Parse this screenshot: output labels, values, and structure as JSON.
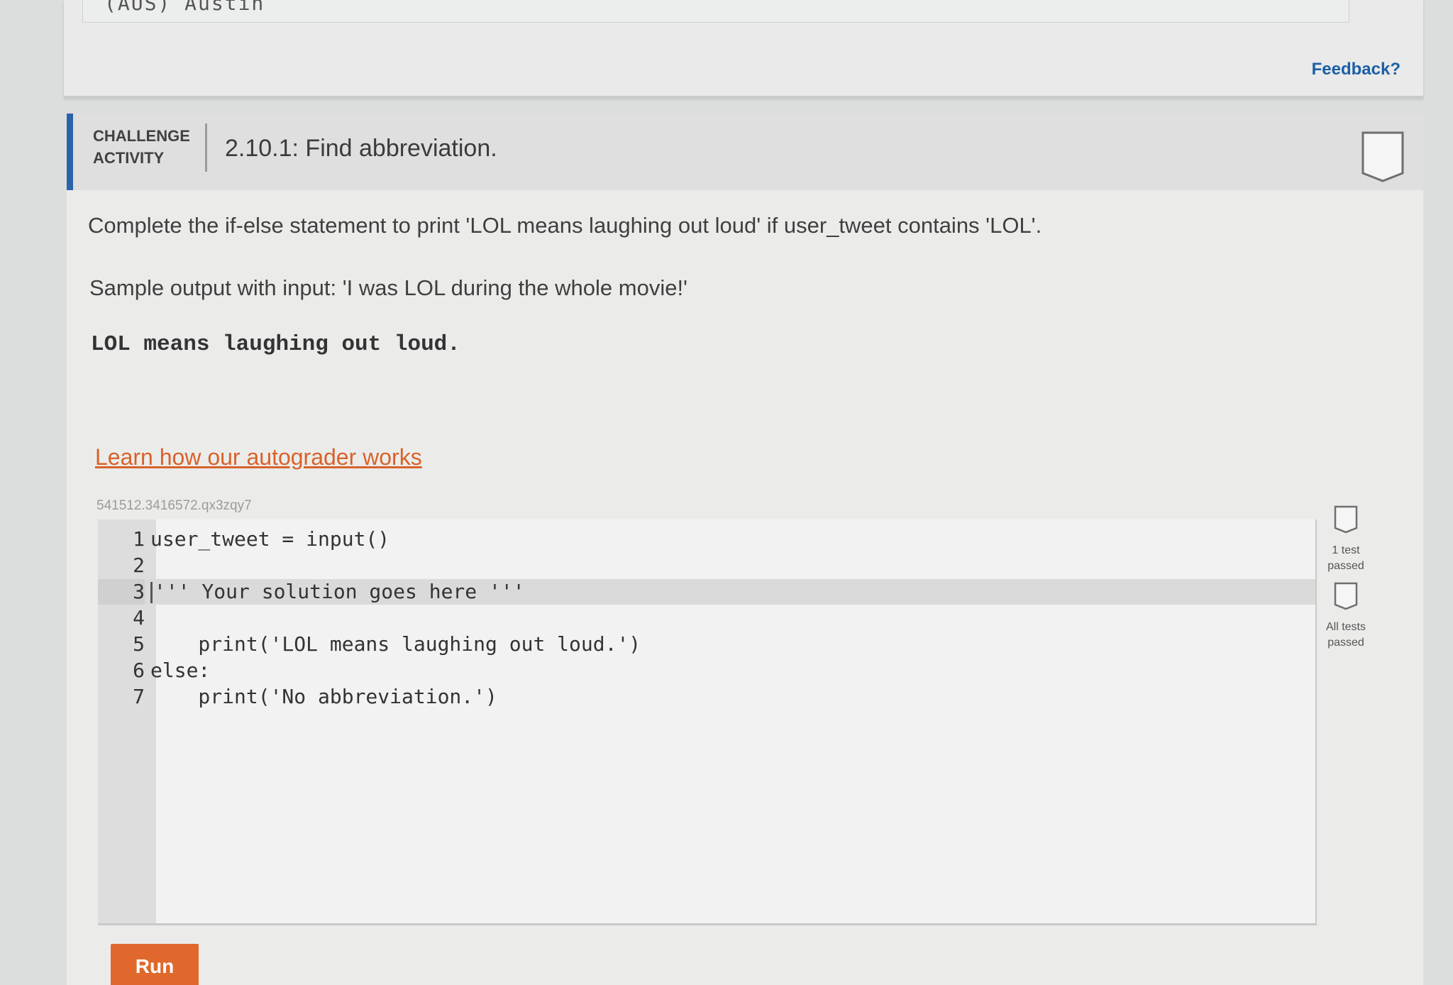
{
  "top_strip": {
    "text": "(AUS) Austin"
  },
  "feedback_label": "Feedback?",
  "activity": {
    "type_label": "CHALLENGE ACTIVITY",
    "title": "2.10.1: Find abbreviation.",
    "instructions": "Complete the if-else statement to print 'LOL means laughing out loud' if user_tweet contains 'LOL'.",
    "sample_label": "Sample output with input: 'I was LOL during the whole movie!'",
    "sample_output": "LOL means laughing out loud.",
    "autograder_link": "Learn how our autograder works",
    "activity_id": "541512.3416572.qx3zqy7"
  },
  "editor": {
    "lines": [
      {
        "num": "1",
        "code": "user_tweet = input()"
      },
      {
        "num": "2",
        "code": ""
      },
      {
        "num": "3",
        "code": "''' Your solution goes here '''"
      },
      {
        "num": "4",
        "code": ""
      },
      {
        "num": "5",
        "code": "    print('LOL means laughing out loud.')"
      },
      {
        "num": "6",
        "code": "else:"
      },
      {
        "num": "7",
        "code": "    print('No abbreviation.')"
      }
    ],
    "active_line": 3
  },
  "tests": {
    "one_label": "1 test passed",
    "all_label": "All tests passed"
  },
  "run_label": "Run",
  "colors": {
    "accent_blue": "#2a63a8",
    "link_orange": "#d9622b",
    "run_button": "#e0682d",
    "feedback_blue": "#1d5fa6"
  }
}
